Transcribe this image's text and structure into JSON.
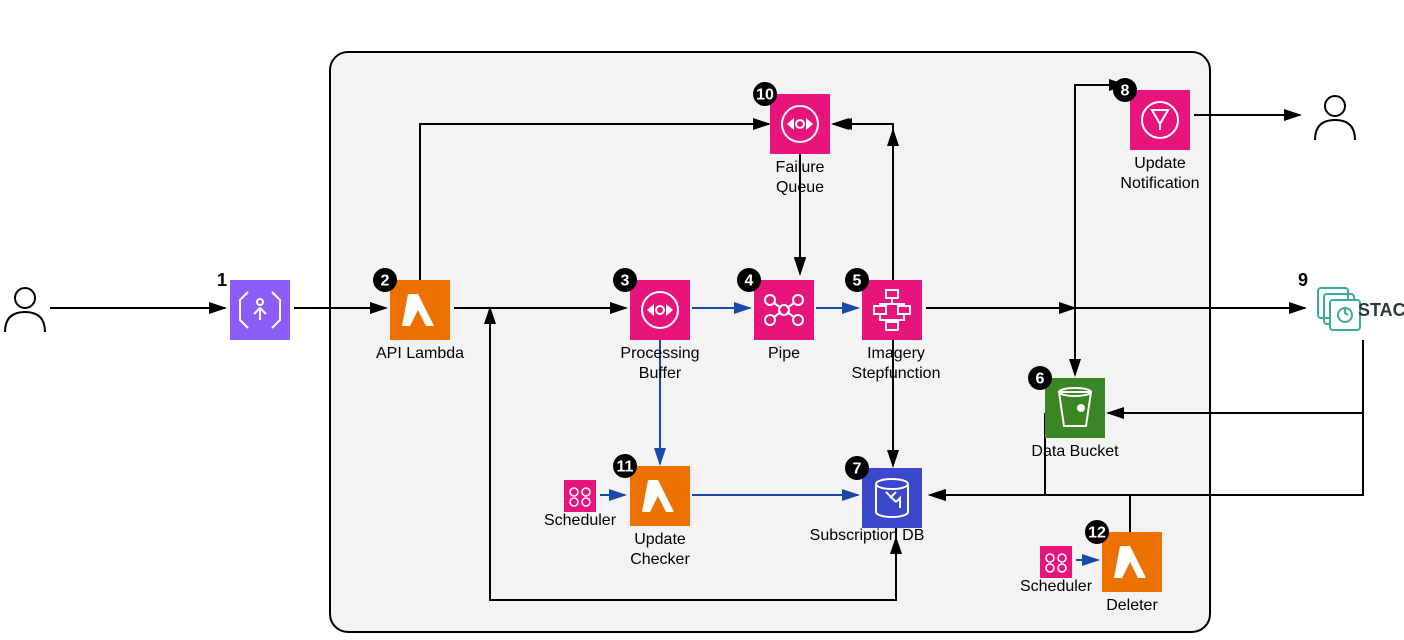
{
  "nodes": {
    "api_lambda": {
      "num": "2",
      "label": "API Lambda"
    },
    "processing_buffer": {
      "num": "3",
      "label1": "Processing",
      "label2": "Buffer"
    },
    "pipe": {
      "num": "4",
      "label": "Pipe"
    },
    "stepfunction": {
      "num": "5",
      "label1": "Imagery",
      "label2": "Stepfunction"
    },
    "data_bucket": {
      "num": "6",
      "label": "Data Bucket"
    },
    "subscription_db": {
      "num": "7",
      "label": "Subscription DB"
    },
    "update_notification": {
      "num": "8",
      "label1": "Update",
      "label2": "Notification"
    },
    "failure_queue": {
      "num": "10",
      "label1": "Failure",
      "label2": "Queue"
    },
    "update_checker": {
      "num": "11",
      "label1": "Update",
      "label2": "Checker"
    },
    "deleter": {
      "num": "12",
      "label": "Deleter"
    },
    "scheduler1": {
      "label": "Scheduler"
    },
    "scheduler2": {
      "label": "Scheduler"
    }
  },
  "external": {
    "api_gateway": {
      "num": "1"
    },
    "stac": {
      "num": "9",
      "label": "STAC"
    }
  }
}
